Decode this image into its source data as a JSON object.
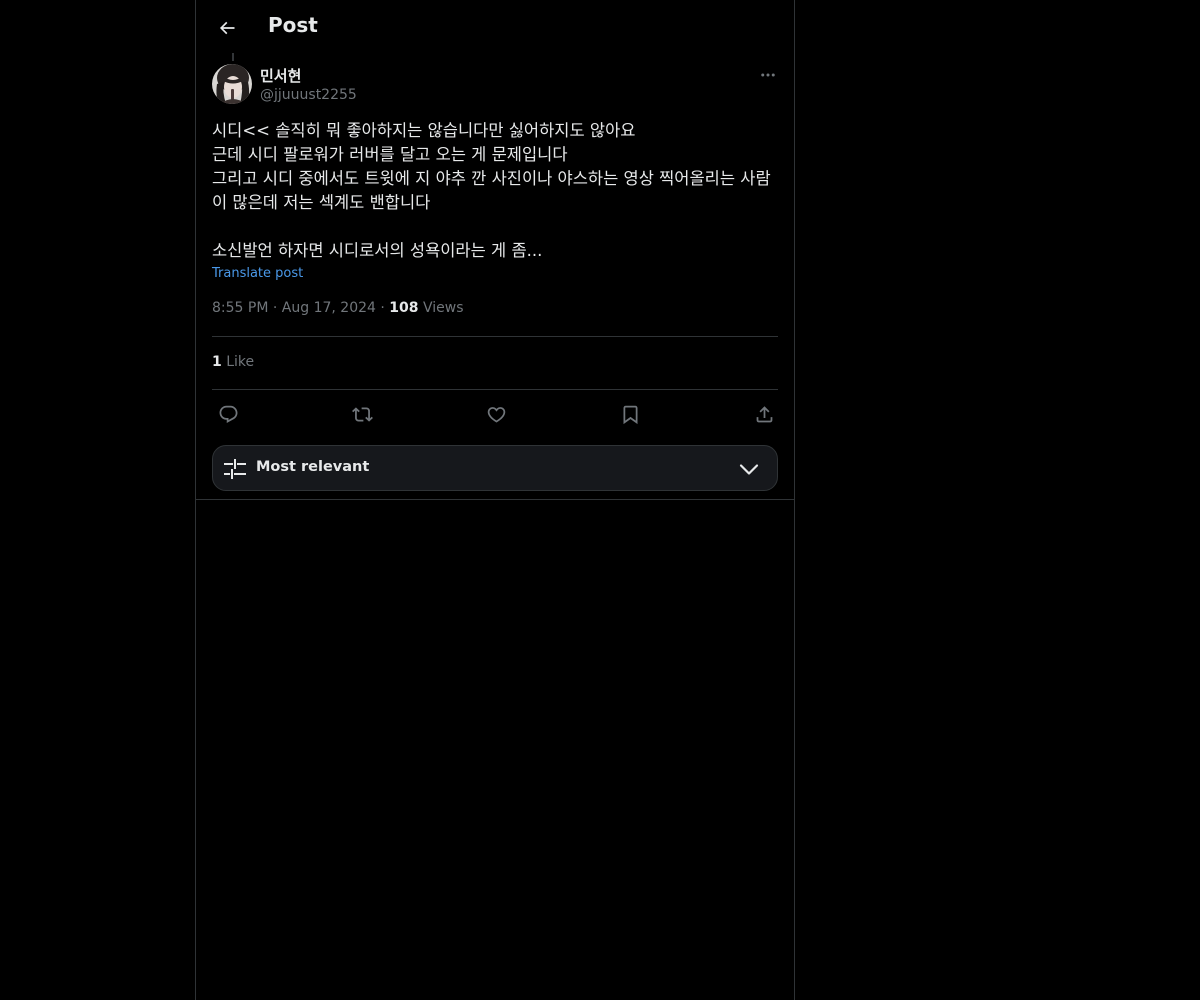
{
  "header": {
    "title": "Post",
    "back_icon": "arrow-left-icon"
  },
  "post": {
    "author": {
      "name": "민서현",
      "handle": "@jjuuust2255"
    },
    "text": "시디<< 솔직히 뭐 좋아하지는 않습니다만 싫어하지도 않아요\n근데 시디 팔로워가 러버를 달고 오는 게 문제입니다\n그리고 시디 중에서도 트윗에 지 야추 깐 사진이나 야스하는 영상 찍어올리는 사람이 많은데 저는 섹계도 밴합니다\n\n소신발언 하자면 시디로서의 성욕이라는 게 좀...",
    "translate_label": "Translate post",
    "time": "8:55 PM",
    "date": "Aug 17, 2024",
    "views_count": "108",
    "views_label": "Views",
    "likes_count": "1",
    "likes_label": "Like"
  },
  "actions": [
    {
      "name": "reply",
      "icon": "reply-icon"
    },
    {
      "name": "repost",
      "icon": "repost-icon"
    },
    {
      "name": "like",
      "icon": "heart-icon"
    },
    {
      "name": "bookmark",
      "icon": "bookmark-icon"
    },
    {
      "name": "share",
      "icon": "share-icon"
    }
  ],
  "sort": {
    "label": "Most relevant"
  },
  "colors": {
    "background": "#000000",
    "text": "#e7e9ea",
    "muted": "#71767b",
    "link": "#4a99e9",
    "border": "#2f3336"
  }
}
